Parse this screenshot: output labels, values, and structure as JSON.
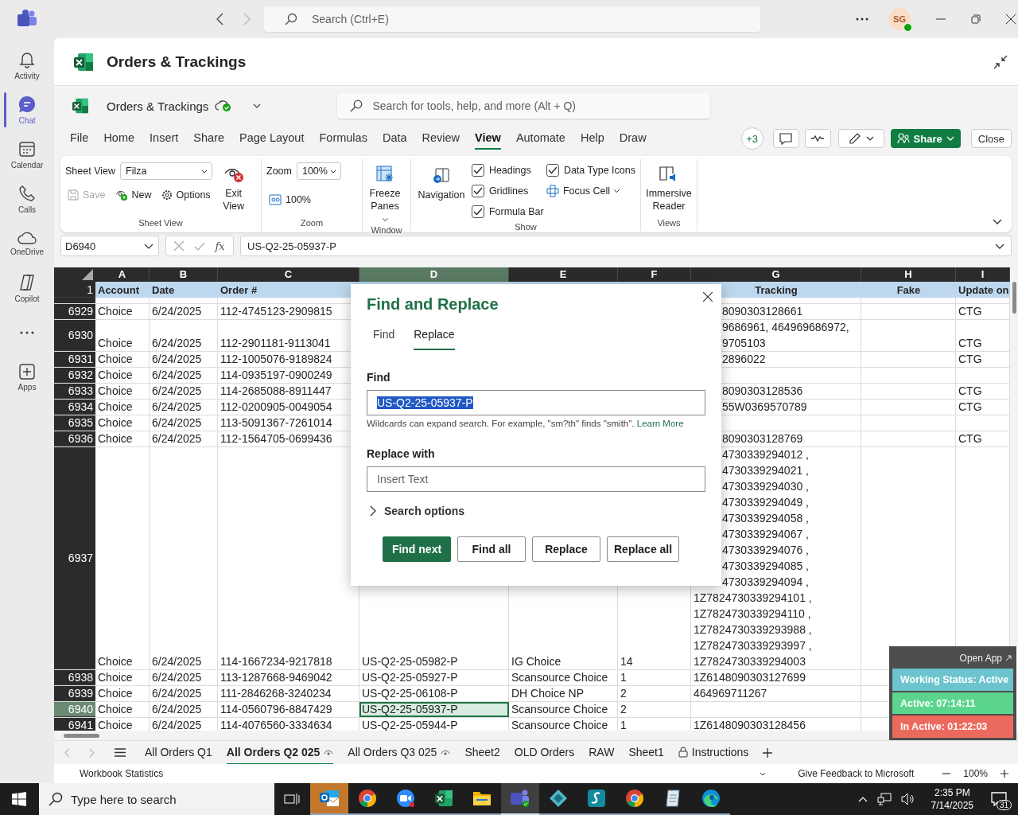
{
  "top_bar": {
    "search": {
      "placeholder": "Search (Ctrl+E)"
    },
    "avatar": "SG"
  },
  "rail": [
    {
      "kind": "bell",
      "label": "Activity",
      "selected": false
    },
    {
      "kind": "chat",
      "label": "Chat",
      "selected": true
    },
    {
      "kind": "calendar",
      "label": "Calendar",
      "selected": false
    },
    {
      "kind": "phone",
      "label": "Calls",
      "selected": false
    },
    {
      "kind": "cloud",
      "label": "OneDrive",
      "selected": false
    },
    {
      "kind": "copilot",
      "label": "Copilot",
      "selected": false
    },
    {
      "kind": "more",
      "selected": false
    },
    {
      "kind": "apps",
      "label": "Apps",
      "selected": false
    }
  ],
  "app": {
    "title": "Orders & Trackings"
  },
  "workbook": {
    "name": "Orders & Trackings",
    "search": {
      "placeholder": "Search for tools, help, and more (Alt + Q)"
    },
    "menu": [
      {
        "label": "File",
        "selected": false
      },
      {
        "label": "Home",
        "selected": false
      },
      {
        "label": "Insert",
        "selected": false
      },
      {
        "label": "Share",
        "selected": false
      },
      {
        "label": "Page Layout",
        "selected": false
      },
      {
        "label": "Formulas",
        "selected": false
      },
      {
        "label": "Data",
        "selected": false
      },
      {
        "label": "Review",
        "selected": false
      },
      {
        "label": "View",
        "selected": true
      },
      {
        "label": "Automate",
        "selected": false
      },
      {
        "label": "Help",
        "selected": false
      },
      {
        "label": "Draw",
        "selected": false
      }
    ],
    "collaborators": "+3",
    "share": "Share",
    "close": "Close"
  },
  "ribbon": {
    "sheet_view": {
      "label": "Sheet View",
      "view": "Filza",
      "save": {
        "label": "Save",
        "disabled": true
      },
      "new": "New",
      "options": "Options",
      "exit": "Exit View",
      "group": "Sheet View"
    },
    "zoom": {
      "label": "Zoom",
      "value": "100%",
      "reset": "100%",
      "group": "Zoom"
    },
    "window": {
      "freeze": "Freeze Panes",
      "group": "Window"
    },
    "show": {
      "navigation": "Navigation",
      "checks": [
        {
          "label": "Headings",
          "checked": true
        },
        {
          "label": "Gridlines",
          "checked": true
        },
        {
          "label": "Formula Bar",
          "checked": true
        },
        {
          "label": "Data Type Icons",
          "checked": true
        }
      ],
      "focus_cell": "Focus Cell",
      "group": "Show"
    },
    "views": {
      "immersive": "Immersive Reader",
      "group": "Views"
    }
  },
  "formula_bar": {
    "name_box": "D6940",
    "fx": "fx",
    "formula": "US-Q2-25-05937-P"
  },
  "grid": {
    "columns": [
      {
        "letter": "A",
        "selected": false
      },
      {
        "letter": "B",
        "selected": false
      },
      {
        "letter": "C",
        "selected": false
      },
      {
        "letter": "D",
        "selected": true
      },
      {
        "letter": "E",
        "selected": false
      },
      {
        "letter": "F",
        "selected": false
      },
      {
        "letter": "G",
        "selected": false
      },
      {
        "letter": "H",
        "selected": false
      },
      {
        "letter": "I",
        "selected": false
      }
    ],
    "header_row": {
      "number": "1",
      "cells": {
        "A": "Account",
        "B": "Date",
        "C": "Order #",
        "G": "Tracking",
        "H": "Fake",
        "I": "Update on"
      }
    },
    "rows": [
      {
        "number": "6929",
        "selected": false,
        "cells": {
          "A": "Choice",
          "B": "6/24/2025",
          "C": "112-4745123-2909815",
          "G": [
            {
              "text": "8090303128661",
              "behind_dialog": true
            }
          ],
          "I": "CTG"
        }
      },
      {
        "number": "6930",
        "selected": false,
        "cells": {
          "A": "Choice",
          "B": "6/24/2025",
          "C": "112-2901181-9113041",
          "G": [
            {
              "text": "9686961, 464969686972,",
              "behind_dialog": true
            },
            {
              "text": "9705103",
              "behind_dialog": true
            }
          ],
          "I": "CTG"
        }
      },
      {
        "number": "6931",
        "selected": false,
        "cells": {
          "A": "Choice",
          "B": "6/24/2025",
          "C": "112-1005076-9189824",
          "G": [
            {
              "text": "2896022",
              "behind_dialog": true
            }
          ],
          "I": "CTG"
        }
      },
      {
        "number": "6932",
        "selected": false,
        "cells": {
          "A": "Choice",
          "B": "6/24/2025",
          "C": "114-0935197-0900249"
        }
      },
      {
        "number": "6933",
        "selected": false,
        "cells": {
          "A": "Choice",
          "B": "6/24/2025",
          "C": "114-2685088-8911447",
          "G": [
            {
              "text": "8090303128536",
              "behind_dialog": true
            }
          ],
          "I": "CTG"
        }
      },
      {
        "number": "6934",
        "selected": false,
        "cells": {
          "A": "Choice",
          "B": "6/24/2025",
          "C": "112-0200905-0049054",
          "G": [
            {
              "text": "55W0369570789",
              "behind_dialog": true
            }
          ],
          "I": "CTG"
        }
      },
      {
        "number": "6935",
        "selected": false,
        "cells": {
          "A": "Choice",
          "B": "6/24/2025",
          "C": "113-5091367-7261014"
        }
      },
      {
        "number": "6936",
        "selected": false,
        "cells": {
          "A": "Choice",
          "B": "6/24/2025",
          "C": "112-1564705-0699436",
          "G": [
            {
              "text": "8090303128769",
              "behind_dialog": true
            }
          ],
          "I": "CTG"
        }
      },
      {
        "number": "6937",
        "selected": false,
        "cells": {
          "A": "Choice",
          "B": "6/24/2025",
          "C": "114-1667234-9217818",
          "D": "US-Q2-25-05982-P",
          "E": "IG Choice",
          "F": "14",
          "G": [
            {
              "text": "4730339294012 ,",
              "behind_dialog": true
            },
            {
              "text": "4730339294021 ,",
              "behind_dialog": true
            },
            {
              "text": "4730339294030 ,",
              "behind_dialog": true
            },
            {
              "text": "4730339294049 ,",
              "behind_dialog": true
            },
            {
              "text": "4730339294058 ,",
              "behind_dialog": true
            },
            {
              "text": "4730339294067 ,",
              "behind_dialog": true
            },
            {
              "text": "4730339294076 ,",
              "behind_dialog": true
            },
            {
              "text": "4730339294085 ,",
              "behind_dialog": true
            },
            {
              "text": "4730339294094 ,",
              "behind_dialog": true
            },
            {
              "text": "1Z7824730339294101 ,",
              "behind_dialog": false
            },
            {
              "text": "1Z7824730339294110 ,",
              "behind_dialog": false
            },
            {
              "text": "1Z7824730339293988 ,",
              "behind_dialog": false
            },
            {
              "text": "1Z7824730339293997 ,",
              "behind_dialog": false
            },
            {
              "text": "1Z7824730339294003",
              "behind_dialog": false
            }
          ]
        }
      },
      {
        "number": "6938",
        "selected": false,
        "cells": {
          "A": "Choice",
          "B": "6/24/2025",
          "C": "113-1287668-9469042",
          "D": "US-Q2-25-05927-P",
          "E": "Scansource Choice",
          "F": "1",
          "G": [
            {
              "text": "1Z6148090303127699",
              "behind_dialog": false
            }
          ]
        }
      },
      {
        "number": "6939",
        "selected": false,
        "cells": {
          "A": "Choice",
          "B": "6/24/2025",
          "C": "111-2846268-3240234",
          "D": "US-Q2-25-06108-P",
          "E": "DH Choice NP",
          "F": "2",
          "G": [
            {
              "text": "464969711267",
              "behind_dialog": false
            }
          ]
        }
      },
      {
        "number": "6940",
        "selected": true,
        "cells": {
          "A": "Choice",
          "B": "6/24/2025",
          "C": "114-0560796-8847429",
          "D": "US-Q2-25-05937-P",
          "E": "Scansource Choice",
          "F": "2"
        }
      },
      {
        "number": "6941",
        "selected": false,
        "cells": {
          "A": "Choice",
          "B": "6/24/2025",
          "C": "114-4076560-3334634",
          "D": "US-Q2-25-05944-P",
          "E": "Scansource Choice",
          "F": "1",
          "G": [
            {
              "text": "1Z6148090303128456",
              "behind_dialog": false
            }
          ]
        }
      }
    ]
  },
  "find_replace": {
    "title": "Find and Replace",
    "tabs": [
      {
        "label": "Find",
        "selected": false
      },
      {
        "label": "Replace",
        "selected": true
      }
    ],
    "find_label": "Find",
    "find_value": "US-Q2-25-05937-P",
    "value_selected": true,
    "hint": "Wildcards can expand search. For example, \"sm?th\" finds \"smith\".",
    "learn_more": "Learn More",
    "replace_label": "Replace with",
    "replace": {
      "placeholder": "Insert Text"
    },
    "search_options": "Search options",
    "buttons": [
      {
        "label": "Find next",
        "kind": "primary"
      },
      {
        "label": "Find all",
        "kind": "secondary"
      },
      {
        "label": "Replace",
        "kind": "secondary"
      },
      {
        "label": "Replace all",
        "kind": "secondary"
      }
    ]
  },
  "status_widget": {
    "open_app": "Open App",
    "rows": [
      {
        "text": "Working Status: Active",
        "color": "#6cc4ce"
      },
      {
        "text": "Active: 07:14:11",
        "color": "#5bd58e"
      },
      {
        "text": "In Active: 01:22:03",
        "color": "#ec6a5d"
      }
    ]
  },
  "sheet_tabs": [
    {
      "label": "All Orders Q1",
      "kind": "plain",
      "selected": false
    },
    {
      "label": "All Orders Q2 025",
      "kind": "view",
      "selected": true
    },
    {
      "label": "All Orders Q3 025",
      "kind": "view",
      "selected": false
    },
    {
      "label": "Sheet2",
      "kind": "plain",
      "selected": false
    },
    {
      "label": "OLD Orders",
      "kind": "plain",
      "selected": false
    },
    {
      "label": "RAW",
      "kind": "plain",
      "selected": false
    },
    {
      "label": "Sheet1",
      "kind": "plain",
      "selected": false
    },
    {
      "label": "Instructions",
      "kind": "locked",
      "selected": false
    }
  ],
  "status_bar": {
    "left": "Workbook Statistics",
    "feedback": "Give Feedback to Microsoft",
    "zoom": "100%"
  },
  "taskbar": {
    "search": {
      "placeholder": "Type here to search"
    },
    "apps": [
      {
        "kind": "mail",
        "attention": true,
        "selected": false
      },
      {
        "kind": "browser",
        "attention": false,
        "selected": false
      },
      {
        "kind": "video",
        "attention": false,
        "selected": false
      },
      {
        "kind": "sheet",
        "attention": false,
        "selected": false
      },
      {
        "kind": "folder",
        "attention": false,
        "selected": false
      },
      {
        "kind": "teams",
        "attention": false,
        "selected": true
      },
      {
        "kind": "diamond",
        "attention": false,
        "selected": false
      },
      {
        "kind": "swoosh",
        "attention": false,
        "selected": false
      },
      {
        "kind": "browser",
        "attention": false,
        "selected": false
      },
      {
        "kind": "notepad",
        "attention": false,
        "selected": false
      },
      {
        "kind": "edge",
        "attention": false,
        "selected": false
      }
    ],
    "time": "2:35 PM",
    "date": "7/14/2025",
    "notifications": "31"
  }
}
